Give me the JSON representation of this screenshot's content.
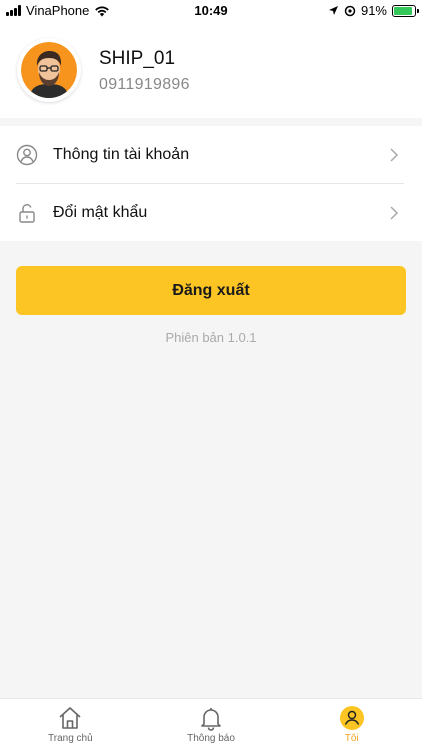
{
  "status_bar": {
    "carrier": "VinaPhone",
    "time": "10:49",
    "battery_percent": "91%",
    "battery_level": 0.91
  },
  "profile": {
    "name": "SHIP_01",
    "phone": "0911919896",
    "avatar_icon": "user-avatar-icon"
  },
  "menu": {
    "items": [
      {
        "label": "Thông tin tài khoản",
        "icon": "user-circle-icon"
      },
      {
        "label": "Đổi mật khẩu",
        "icon": "unlock-icon"
      }
    ]
  },
  "actions": {
    "logout_label": "Đăng xuất"
  },
  "version_text": "Phiên bản 1.0.1",
  "tabbar": {
    "tabs": [
      {
        "label": "Trang chủ",
        "icon": "home-icon",
        "active": false
      },
      {
        "label": "Thông báo",
        "icon": "bell-icon",
        "active": false
      },
      {
        "label": "Tôi",
        "icon": "user-icon",
        "active": true
      }
    ]
  },
  "colors": {
    "accent": "#fcc524",
    "active_tab": "#f5a623",
    "background": "#f5f5f5"
  }
}
